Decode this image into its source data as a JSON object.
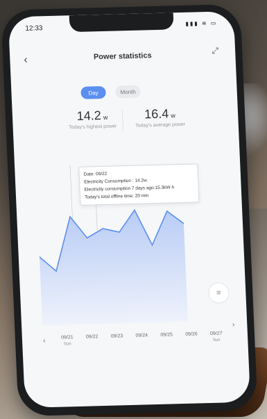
{
  "status_bar": {
    "time": "12:33",
    "icons": "▮▮▮ ≋ ▭"
  },
  "header": {
    "title": "Power statistics",
    "back_icon": "chevron-left-icon",
    "share_icon": "share-icon"
  },
  "segments": {
    "day": "Day",
    "month": "Month",
    "selected": "Day"
  },
  "stats": {
    "highest": {
      "value": "14.2",
      "unit": "w",
      "label": "Today's highest power"
    },
    "average": {
      "value": "16.4",
      "unit": "w",
      "label": "Today's average power"
    }
  },
  "tooltip": {
    "date": "Date: 09/22",
    "consumption": "Electricity Consumption : 14.2w",
    "consumption_7d": "Electricity consumption 7 days ago:15.3kW·h",
    "offline": "Today's total offline time: 20 min"
  },
  "x_axis": {
    "labels": [
      "09/21",
      "09/22",
      "09/23",
      "09/24",
      "09/25",
      "09/26",
      "09/27"
    ],
    "sublabels": [
      "Sun",
      "",
      "",
      "",
      "",
      "",
      "Sun"
    ]
  },
  "chart_data": {
    "type": "area",
    "x": [
      "09/21",
      "09/21b",
      "09/22",
      "09/22b",
      "09/22c",
      "09/23",
      "09/23b",
      "09/24",
      "09/24b",
      "09/25"
    ],
    "values": [
      12.5,
      11.0,
      16.5,
      14.3,
      15.2,
      14.8,
      17.0,
      13.4,
      16.8,
      15.5
    ],
    "colors": {
      "line": "#5b8ff0",
      "fill_top": "#b9ccf6",
      "fill_bottom": "#eef2fb"
    }
  }
}
